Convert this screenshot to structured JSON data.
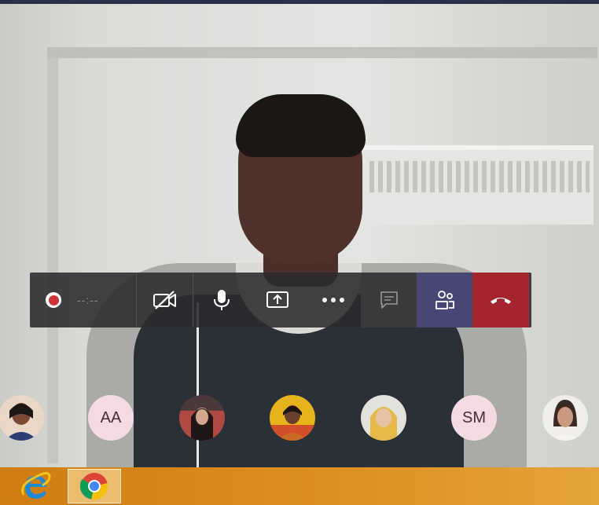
{
  "call": {
    "record_timer": "--:--",
    "colors": {
      "bar_bg": "#2a2a2c",
      "people_bg": "#464775",
      "hangup_bg": "#a4262c",
      "record_red": "#d13438",
      "taskbar": "#d98a1a"
    },
    "controls": [
      {
        "name": "record",
        "icon": "record-icon"
      },
      {
        "name": "camera-off",
        "icon": "video-off-icon"
      },
      {
        "name": "microphone",
        "icon": "microphone-icon"
      },
      {
        "name": "share-screen",
        "icon": "share-screen-icon"
      },
      {
        "name": "more-actions",
        "icon": "more-options-icon"
      },
      {
        "name": "chat",
        "icon": "chat-icon"
      },
      {
        "name": "participants",
        "icon": "people-icon"
      },
      {
        "name": "hang-up",
        "icon": "hang-up-icon"
      }
    ]
  },
  "participants": [
    {
      "type": "photo",
      "icon": "participant-photo"
    },
    {
      "type": "initials",
      "initials": "AA"
    },
    {
      "type": "photo",
      "icon": "participant-photo"
    },
    {
      "type": "photo",
      "icon": "participant-photo"
    },
    {
      "type": "photo",
      "icon": "participant-photo"
    },
    {
      "type": "initials",
      "initials": "SM"
    },
    {
      "type": "photo",
      "icon": "participant-photo"
    }
  ],
  "taskbar": {
    "apps": [
      {
        "name": "internet-explorer",
        "icon": "internet-explorer-icon"
      },
      {
        "name": "google-chrome",
        "icon": "chrome-icon",
        "active": true
      }
    ]
  }
}
